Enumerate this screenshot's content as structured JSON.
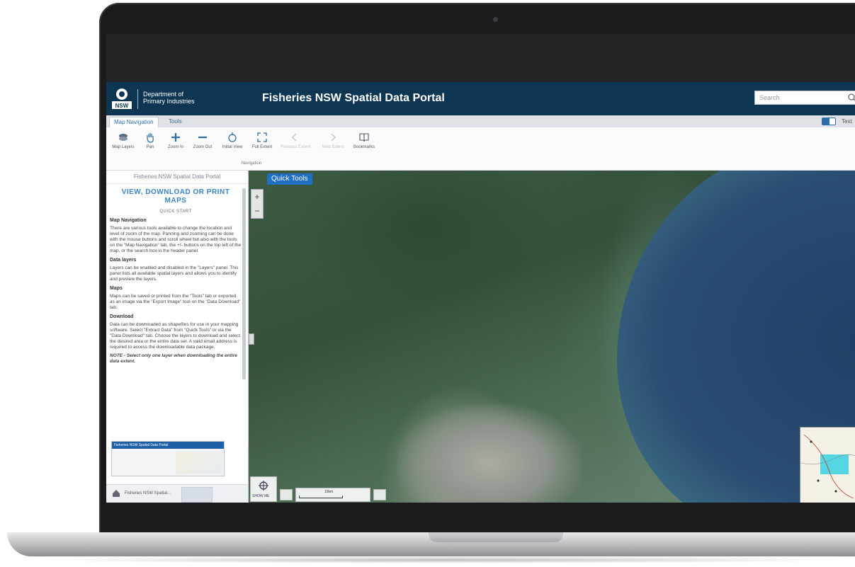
{
  "header": {
    "org_line1": "Department of",
    "org_line2": "Primary Industries",
    "logo_text": "NSW",
    "title": "Fisheries NSW Spatial Data Portal",
    "search_placeholder": "Search"
  },
  "ribbon": {
    "tabs": [
      "Map Navigation",
      "Tools"
    ],
    "toggle_label": "Text"
  },
  "toolbar": {
    "tools": [
      {
        "label": "Map Layers",
        "icon": "layers-icon"
      },
      {
        "label": "Pan",
        "icon": "hand-icon"
      },
      {
        "label": "Zoom In",
        "icon": "plus-icon"
      },
      {
        "label": "Zoom Out",
        "icon": "minus-icon"
      },
      {
        "label": "Initial View",
        "icon": "home-icon"
      },
      {
        "label": "Full Extent",
        "icon": "extent-icon"
      },
      {
        "label": "Previous Extent",
        "icon": "back-icon"
      },
      {
        "label": "Next Extent",
        "icon": "forward-icon"
      },
      {
        "label": "Bookmarks",
        "icon": "book-icon"
      }
    ],
    "group_label": "Navigation"
  },
  "sidebar": {
    "header": "Fisheries NSW Spatial Data Portal",
    "collapse_glyph": "‹",
    "title": "VIEW, DOWNLOAD OR PRINT MAPS",
    "subtitle": "QUICK START",
    "sections": [
      {
        "heading": "Map Navigation",
        "body": "There are various tools available to change the location and level of zoom of the map. Panning and zooming can be done with the mouse buttons and scroll wheel but also with the tools on the \"Map Navigation\" tab, the +/- buttons on the top left of the map, or the search box in the header panel."
      },
      {
        "heading": "Data layers",
        "body": "Layers can be enabled and disabled in the \"Layers\" panel. This panel lists all available spatial layers and allows you to identify and preview the layers."
      },
      {
        "heading": "Maps",
        "body": "Maps can be saved or printed from the \"Tools\" tab or exported as an image via the \"Export Image\" tool on the \"Data Download\" tab."
      },
      {
        "heading": "Download",
        "body": "Data can be downloaded as shapefiles for use in your mapping software. Select \"Extract Data\" from \"Quick Tools\" or via the \"Data Download\" tab. Choose the layers to download and select the desired area or the entire data set. A valid email address is required to access the downloadable data package."
      }
    ],
    "note": "NOTE - Select only one layer when downloading the entire data extent.",
    "preview_title": "Fisheries NSW Spatial Data Portal",
    "footer_label": "Fisheries NSW Spatial..."
  },
  "map": {
    "quick_tools": "Quick Tools",
    "zoom_in": "+",
    "zoom_out": "−",
    "bottom_button_label": "SHOW ME",
    "scale_label": "10km"
  },
  "colors": {
    "header_bg": "#0e3653",
    "accent": "#1f6fc4",
    "sidebar_title": "#3a84c4"
  }
}
